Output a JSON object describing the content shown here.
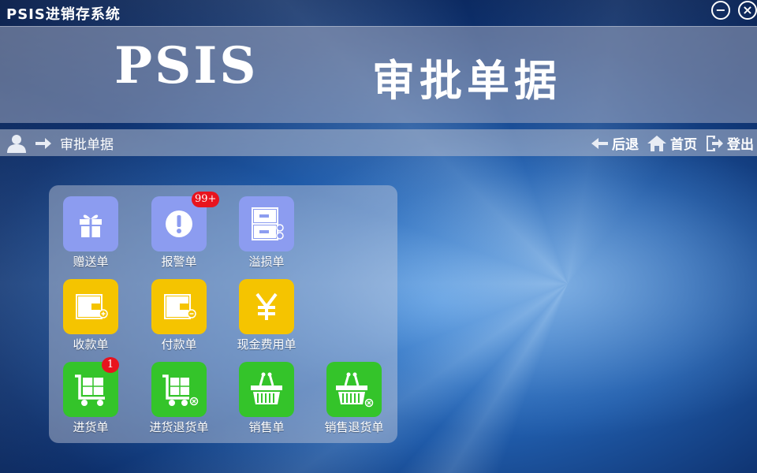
{
  "window": {
    "title": "PSIS进销存系统",
    "minimize_label": "−",
    "close_label": "×"
  },
  "banner": {
    "brand": "PSIS",
    "heading": "审批单据"
  },
  "navbar": {
    "breadcrumb": "审批单据",
    "back_label": "后退",
    "home_label": "首页",
    "logout_label": "登出"
  },
  "tiles": [
    {
      "label": "赠送单",
      "color": "#8c9cf0",
      "icon": "gift-icon"
    },
    {
      "label": "报警单",
      "color": "#8c9cf0",
      "icon": "alert-icon",
      "badge": "99+"
    },
    {
      "label": "溢损单",
      "color": "#8c9cf0",
      "icon": "cabinet-icon"
    },
    {
      "label": "收款单",
      "color": "#f5c400",
      "icon": "wallet-plus-icon"
    },
    {
      "label": "付款单",
      "color": "#f5c400",
      "icon": "wallet-minus-icon"
    },
    {
      "label": "现金费用单",
      "color": "#f5c400",
      "icon": "yen-icon"
    },
    {
      "label": "进货单",
      "color": "#34c42a",
      "icon": "cart-icon",
      "badge": "1"
    },
    {
      "label": "进货退货单",
      "color": "#34c42a",
      "icon": "cart-return-icon"
    },
    {
      "label": "销售单",
      "color": "#34c42a",
      "icon": "basket-icon"
    },
    {
      "label": "销售退货单",
      "color": "#34c42a",
      "icon": "basket-return-icon"
    }
  ]
}
